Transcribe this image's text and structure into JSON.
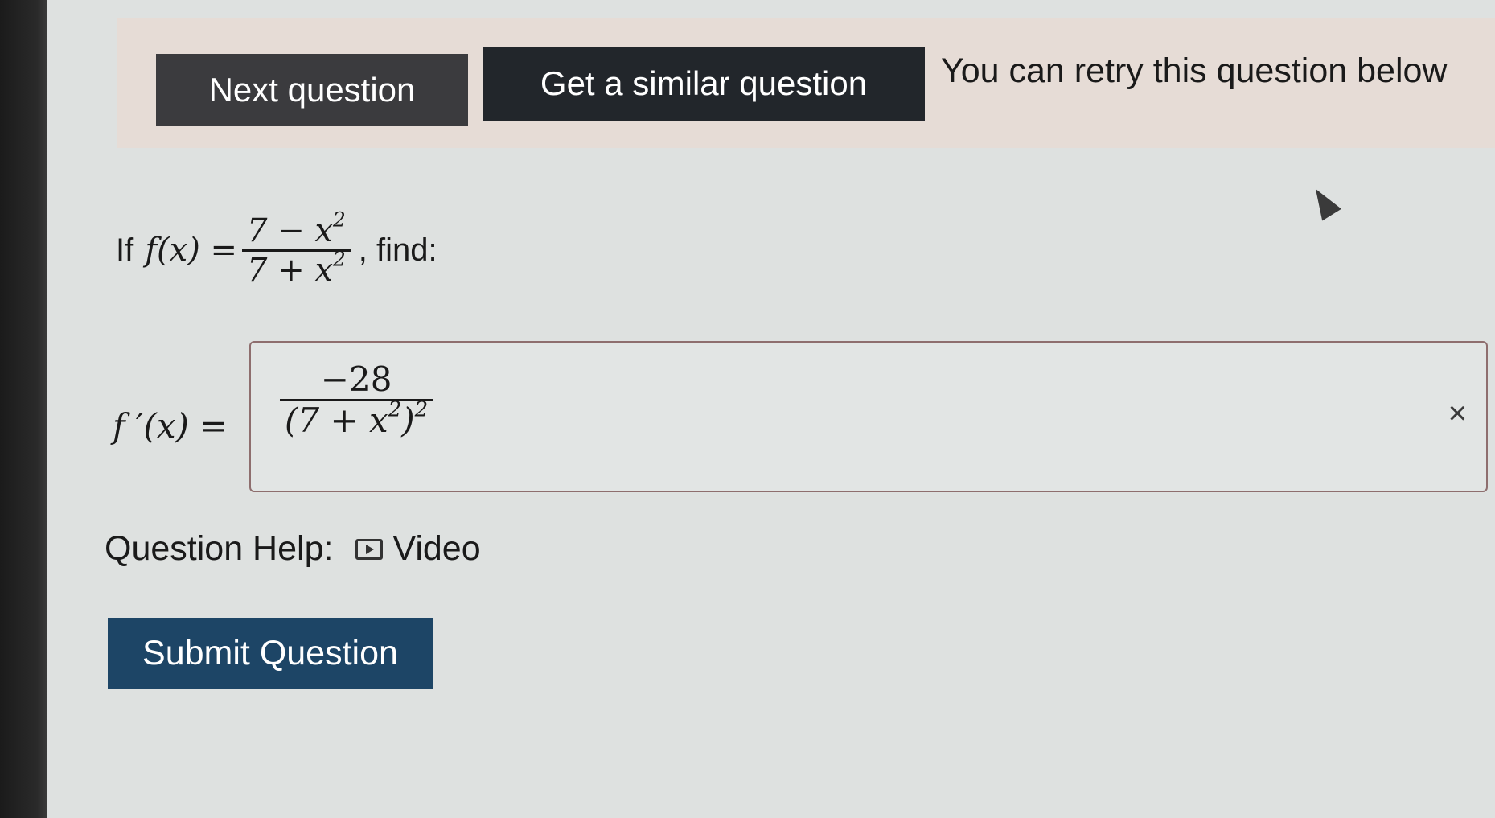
{
  "toolbar": {
    "next_label": "Next question",
    "similar_label": "Get a similar question",
    "retry_message": "You can retry this question below"
  },
  "question": {
    "prefix": "If",
    "function_lhs": "f(x) =",
    "numerator": "7 − x",
    "denominator": "7 + x",
    "exponent": "2",
    "suffix": ", find:"
  },
  "answer": {
    "label": "f ′(x) =",
    "numerator": "−28",
    "denominator": "(7 + x",
    "inner_exponent": "2",
    "closing": ")",
    "outer_exponent": "2",
    "status_mark": "×"
  },
  "help": {
    "label": "Question Help:",
    "video_label": "Video"
  },
  "submit": {
    "label": "Submit Question"
  },
  "colors": {
    "next_button": "#3b3b3e",
    "similar_button": "#22262b",
    "submit_button": "#1d4566",
    "header_band": "#e6dcd6",
    "answer_border": "#8e6e6e"
  }
}
